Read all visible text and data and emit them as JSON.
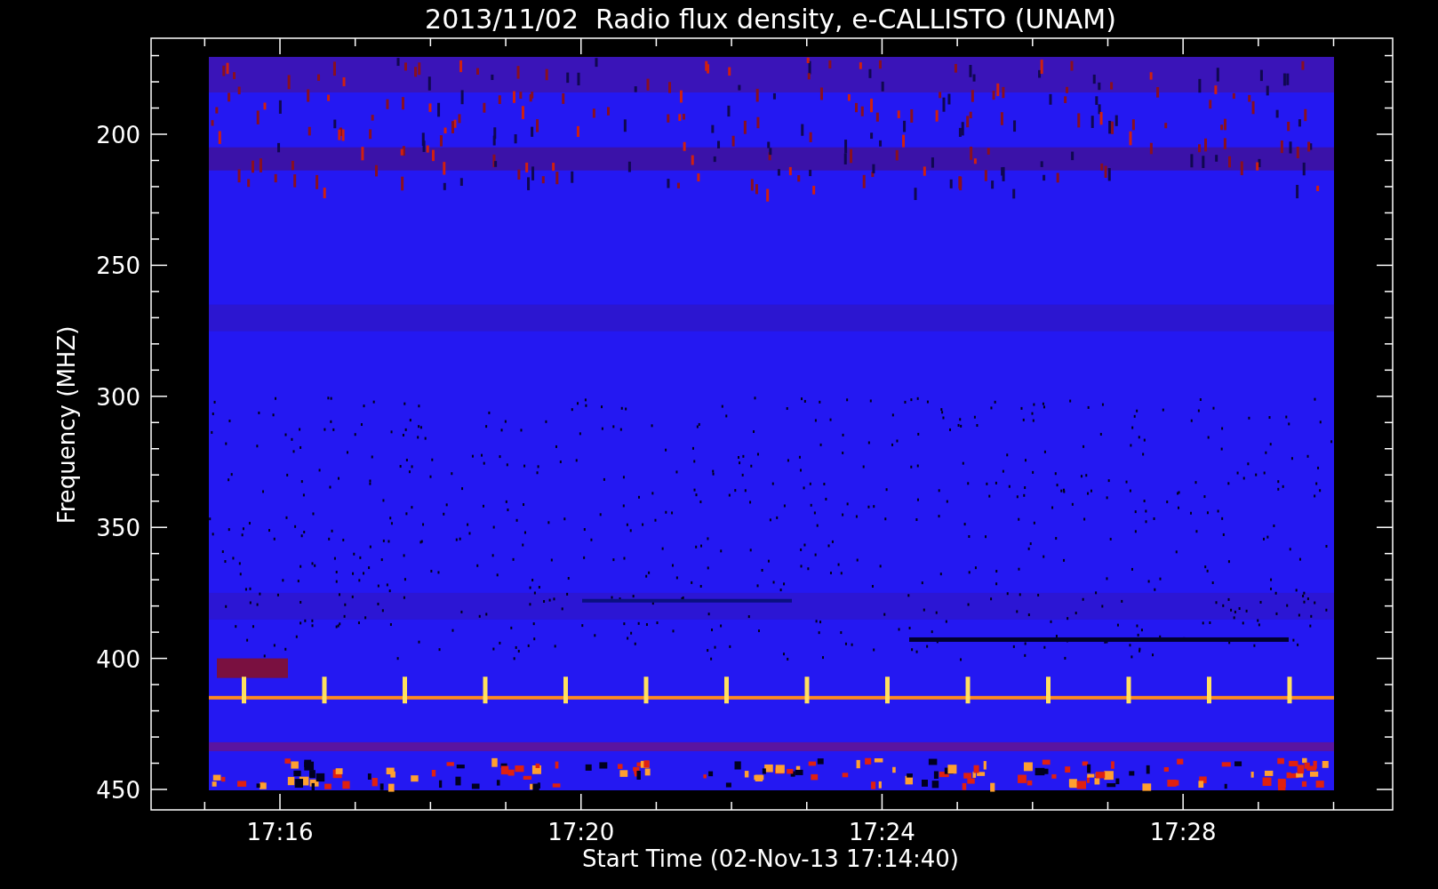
{
  "title": "2013/11/02  Radio flux density, e-CALLISTO (UNAM)",
  "y_axis": {
    "label": "Frequency (MHZ)",
    "ticks": [
      "200",
      "250",
      "300",
      "350",
      "400",
      "450"
    ]
  },
  "x_axis": {
    "label": "Start Time (02-Nov-13 17:14:40)",
    "ticks": [
      "17:16",
      "17:20",
      "17:24",
      "17:28"
    ]
  }
}
